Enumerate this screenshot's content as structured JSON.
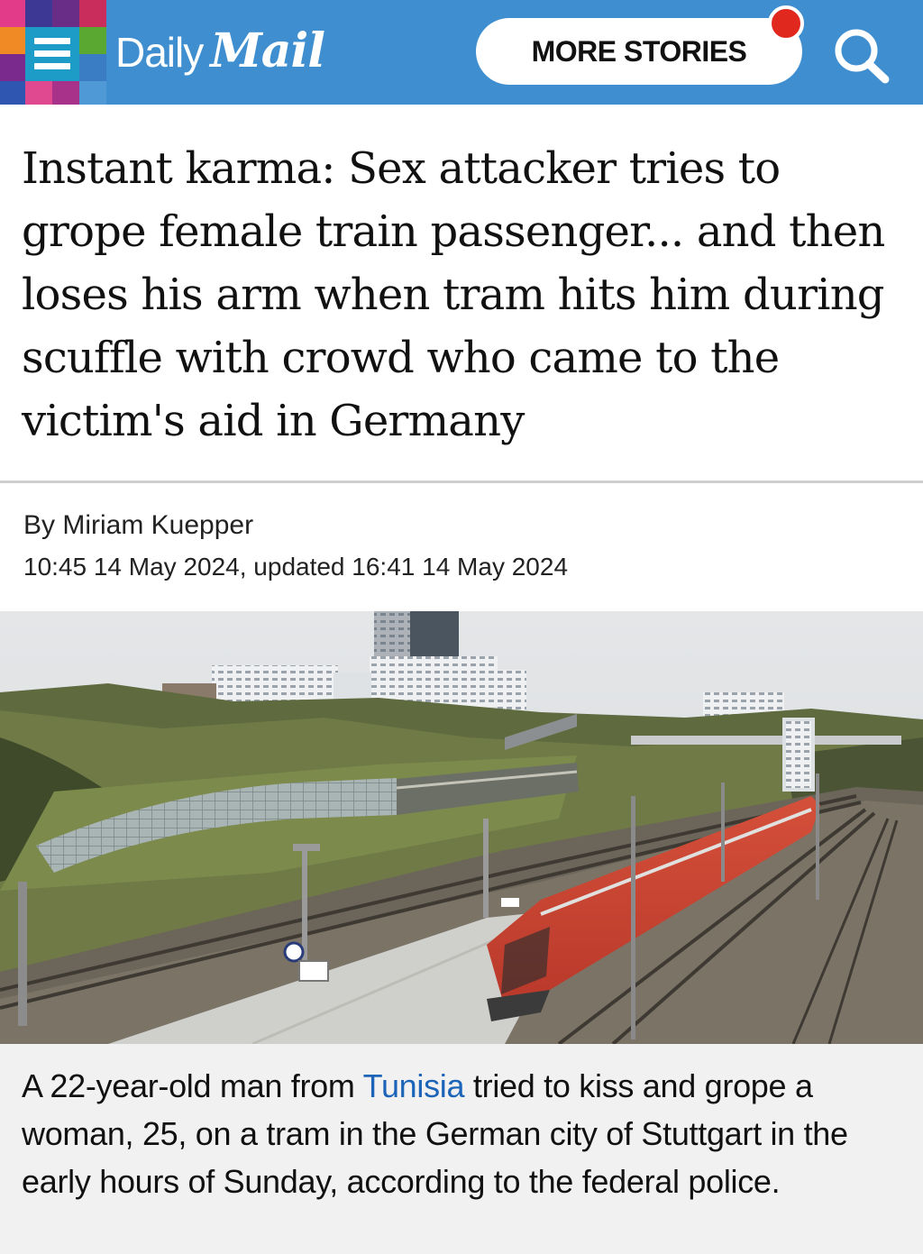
{
  "header": {
    "brand_daily": "Daily",
    "brand_mail": "Mail",
    "more_stories_label": "MORE STORIES",
    "menu_icon": "hamburger-icon",
    "search_icon": "search-icon",
    "header_bg": "#3f8fd0",
    "notification_color": "#e0281f"
  },
  "article": {
    "headline": "Instant karma: Sex attacker tries to grope female train passenger... and then loses his arm when tram hits him during scuffle with crowd who came to the victim's aid in Germany",
    "byline": "By Miriam Kuepper",
    "timestamp": "10:45 14 May 2024, updated 16:41 14 May 2024"
  },
  "caption": {
    "part1": "A 22-year-old man from ",
    "link": "Tunisia",
    "part2": " tried to kiss and grope a woman, 25, on a tram in the German city of Stuttgart in the early hours of Sunday, according to the federal police.",
    "link_color": "#1b64b8"
  }
}
